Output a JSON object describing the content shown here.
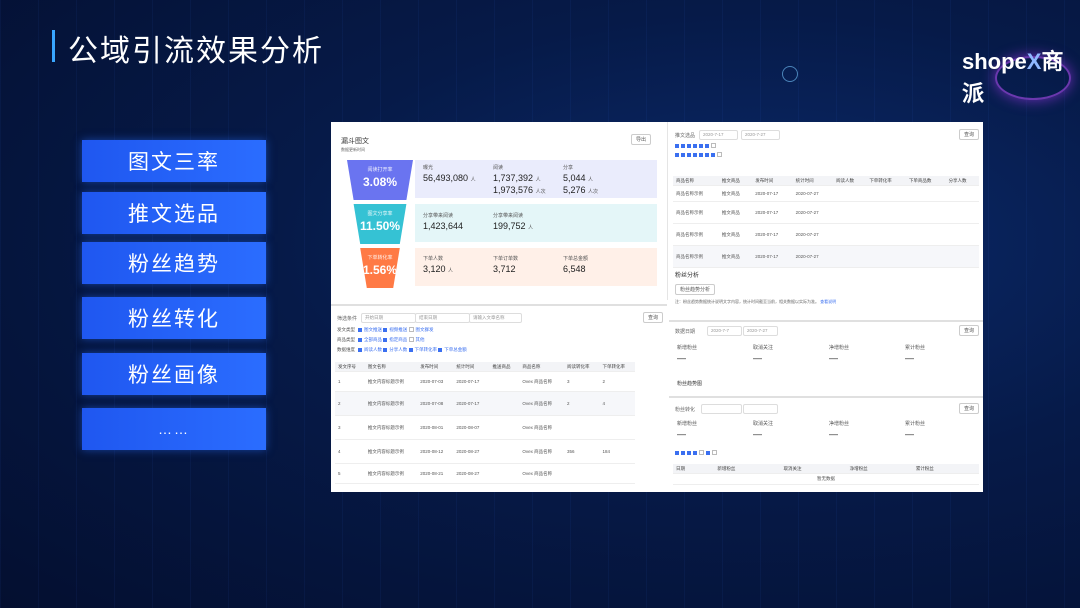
{
  "header": {
    "title": "公域引流效果分析",
    "logo_text": "shope",
    "logo_x": "X",
    "logo_cn": "商派"
  },
  "menu": [
    {
      "label": "图文三率"
    },
    {
      "label": "推文选品"
    },
    {
      "label": "粉丝趋势"
    },
    {
      "label": "粉丝转化"
    },
    {
      "label": "粉丝画像"
    },
    {
      "label": "……"
    }
  ],
  "colors": {
    "accent": "#2b6dff",
    "funnel_top": "#6a74f0",
    "funnel_mid": "#35c2d4",
    "funnel_bot": "#ff7a45"
  },
  "screenshot": {
    "panel_a": {
      "title": "漏斗图文",
      "subtitle": "数据更新时间",
      "export": "导出",
      "funnel": [
        {
          "label": "阅读打开率",
          "value": "3.08%"
        },
        {
          "label": "图文分享率",
          "value": "11.50%"
        },
        {
          "label": "下单转化率",
          "value": "1.56%"
        }
      ],
      "row1": {
        "s1_label": "曝光",
        "s1_value": "56,493,080",
        "s1_unit": "人",
        "s2_label": "阅读",
        "s2_value": "1,737,392",
        "s2_unit": "人",
        "s2_value2": "1,973,576",
        "s2_unit2": "人次",
        "s3_label": "分享",
        "s3_value": "5,044",
        "s3_unit": "人",
        "s3_value2": "5,276",
        "s3_unit2": "人次"
      },
      "row2": {
        "s1_label": "分享带来阅读",
        "s1_value": "1,423,644",
        "s2_label": "分享带来阅读",
        "s2_value": "199,752",
        "s2_unit": "人"
      },
      "row3": {
        "s1_label": "下单人数",
        "s1_value": "3,120",
        "s1_unit": "人",
        "s2_label": "下单订单数",
        "s2_value": "3,712",
        "s3_label": "下单总金额",
        "s3_value": "6,548"
      }
    },
    "panel_b": {
      "search_label": "筛选条件",
      "start_placeholder": "开始日期",
      "end_placeholder": "结束日期",
      "keyword_placeholder": "请输入文章名称",
      "query": "查询",
      "filters": [
        {
          "key": "发文类型",
          "items": [
            "图文推送",
            "视频推送",
            "图文群发"
          ]
        },
        {
          "key": "商品类型",
          "items": [
            "全部商品",
            "指定商品",
            "其他"
          ]
        },
        {
          "key": "数据维度",
          "items": [
            "阅读人数",
            "分享人数",
            "下单转化率",
            "下单总金额"
          ]
        }
      ],
      "columns": [
        "发文序号",
        "图文名称",
        "发布时间",
        "统计时间",
        "推送商品",
        "商品名称",
        "阅读转化率",
        "下单转化率"
      ],
      "rows": [
        [
          "1",
          "推文内容标题示例",
          "2020-07-03",
          "2020-07-17",
          "",
          "Ovex 商品名称",
          "3",
          "2"
        ],
        [
          "2",
          "推文内容标题示例",
          "2020-07-08",
          "2020-07-17",
          "",
          "Ovex 商品名称",
          "2",
          "4"
        ],
        [
          "3",
          "推文内容标题示例",
          "2020-08-01",
          "2020-08-07",
          "",
          "Ovex 商品名称",
          "",
          ""
        ],
        [
          "4",
          "推文内容标题示例",
          "2020-08-12",
          "2020-08-27",
          "",
          "Ovex 商品名称",
          "356",
          "184"
        ],
        [
          "5",
          "推文内容标题示例",
          "2020-08-21",
          "2020-08-27",
          "",
          "Ovex 商品名称",
          "",
          ""
        ]
      ]
    },
    "panel_c": {
      "search_label": "推文选品",
      "start": "2020-7-17",
      "end": "2020-7-27",
      "query": "查询",
      "columns": [
        "商品名称",
        "推文商品",
        "发布时间",
        "统计时间",
        "阅读人数",
        "下单转化率",
        "下单商品数",
        "分享人数"
      ],
      "rows": [
        [
          "商品名称示例",
          "推文商品",
          "2020-07-17",
          "2020-07-27",
          "",
          "",
          "",
          ""
        ],
        [
          "商品名称示例",
          "推文商品",
          "2020-07-17",
          "2020-07-27",
          "",
          "",
          "",
          ""
        ],
        [
          "商品名称示例",
          "推文商品",
          "2020-07-17",
          "2020-07-27",
          "",
          "",
          "",
          ""
        ],
        [
          "商品名称示例",
          "推文商品",
          "2020-07-17",
          "2020-07-27",
          "",
          "",
          "",
          ""
        ]
      ],
      "fans_title": "粉丝分析",
      "fans_tab": "粉丝趋势分析",
      "fans_note": "注：粉丝趋势数据统计说明文字内容，统计时间截至当前，相关数据以实际为准。",
      "fans_link": "查看说明"
    },
    "panel_d": {
      "search_label": "数据日期",
      "start": "2020-7-7",
      "end": "2020-7-27",
      "query": "查询",
      "metrics": [
        "新增粉丝",
        "取消关注",
        "净增粉丝",
        "累计粉丝"
      ],
      "value": "—",
      "chart_title": "粉丝趋势图"
    },
    "panel_e": {
      "search_label": "粉丝转化",
      "query": "查询",
      "metrics": [
        "新增粉丝",
        "取消关注",
        "净增粉丝",
        "累计粉丝"
      ],
      "value": "—",
      "columns": [
        "日期",
        "新增粉丝",
        "取消关注",
        "净增粉丝",
        "累计粉丝"
      ],
      "footer": "暂无数据"
    }
  }
}
